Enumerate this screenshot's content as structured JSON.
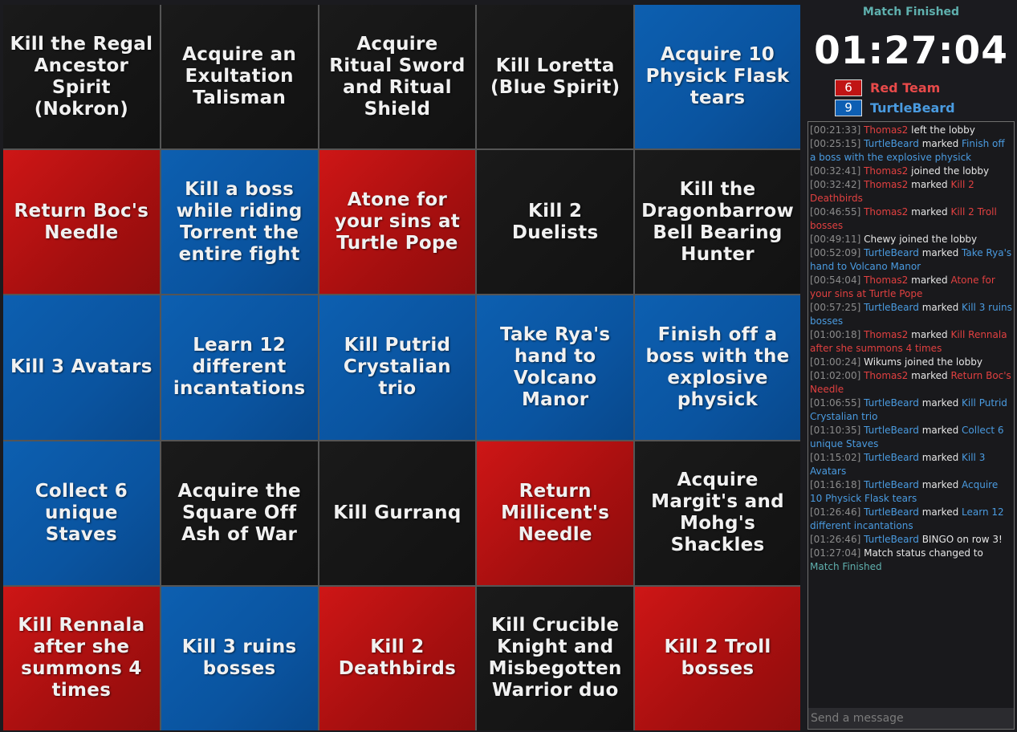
{
  "board": {
    "cells": [
      {
        "text": "Kill the Regal Ancestor Spirit (Nokron)",
        "owner": "none"
      },
      {
        "text": "Acquire an Exultation Talisman",
        "owner": "none"
      },
      {
        "text": "Acquire Ritual Sword and Ritual Shield",
        "owner": "none"
      },
      {
        "text": "Kill Loretta (Blue Spirit)",
        "owner": "none"
      },
      {
        "text": "Acquire 10 Physick Flask tears",
        "owner": "blue"
      },
      {
        "text": "Return Boc's Needle",
        "owner": "red"
      },
      {
        "text": "Kill a boss while riding Torrent the entire fight",
        "owner": "blue"
      },
      {
        "text": "Atone for your sins at Turtle Pope",
        "owner": "red"
      },
      {
        "text": "Kill 2 Duelists",
        "owner": "none"
      },
      {
        "text": "Kill the Dragonbarrow Bell Bearing Hunter",
        "owner": "none"
      },
      {
        "text": "Kill 3 Avatars",
        "owner": "blue"
      },
      {
        "text": "Learn 12 different incantations",
        "owner": "blue"
      },
      {
        "text": "Kill Putrid Crystalian trio",
        "owner": "blue"
      },
      {
        "text": "Take Rya's hand to Volcano Manor",
        "owner": "blue"
      },
      {
        "text": "Finish off a boss with the explosive physick",
        "owner": "blue"
      },
      {
        "text": "Collect 6 unique Staves",
        "owner": "blue"
      },
      {
        "text": "Acquire the Square Off Ash of War",
        "owner": "none"
      },
      {
        "text": "Kill Gurranq",
        "owner": "none"
      },
      {
        "text": "Return Millicent's Needle",
        "owner": "red"
      },
      {
        "text": "Acquire Margit's and Mohg's Shackles",
        "owner": "none"
      },
      {
        "text": "Kill Rennala after she summons 4 times",
        "owner": "red"
      },
      {
        "text": "Kill 3 ruins bosses",
        "owner": "blue"
      },
      {
        "text": "Kill 2 Deathbirds",
        "owner": "red"
      },
      {
        "text": "Kill Crucible Knight and Misbegotten Warrior duo",
        "owner": "none"
      },
      {
        "text": "Kill 2 Troll bosses",
        "owner": "red"
      }
    ]
  },
  "match": {
    "status": "Match Finished",
    "timer": "01:27:04"
  },
  "teams": {
    "red": {
      "count": "6",
      "name": "Red Team",
      "color": "#c01414"
    },
    "blue": {
      "count": "9",
      "name": "TurtleBeard",
      "color": "#0e5fb3"
    }
  },
  "chat": {
    "placeholder": "Send a message",
    "log": [
      {
        "time": "[00:21:33]",
        "user": "Thomas2",
        "team": "red",
        "action": " left the lobby",
        "goal": ""
      },
      {
        "time": "[00:25:15]",
        "user": "TurtleBeard",
        "team": "blue",
        "action": " marked ",
        "goal": "Finish off a boss with the explosive physick"
      },
      {
        "time": "[00:32:41]",
        "user": "Thomas2",
        "team": "red",
        "action": " joined the lobby",
        "goal": ""
      },
      {
        "time": "[00:32:42]",
        "user": "Thomas2",
        "team": "red",
        "action": " marked ",
        "goal": "Kill 2 Deathbirds"
      },
      {
        "time": "[00:46:55]",
        "user": "Thomas2",
        "team": "red",
        "action": " marked ",
        "goal": "Kill 2 Troll bosses"
      },
      {
        "time": "[00:49:11]",
        "user": "Chewy",
        "team": "plain",
        "action": " joined the lobby",
        "goal": ""
      },
      {
        "time": "[00:52:09]",
        "user": "TurtleBeard",
        "team": "blue",
        "action": " marked ",
        "goal": "Take Rya's hand to Volcano Manor"
      },
      {
        "time": "[00:54:04]",
        "user": "Thomas2",
        "team": "red",
        "action": " marked ",
        "goal": "Atone for your sins at Turtle Pope"
      },
      {
        "time": "[00:57:25]",
        "user": "TurtleBeard",
        "team": "blue",
        "action": " marked ",
        "goal": "Kill 3 ruins bosses"
      },
      {
        "time": "[01:00:18]",
        "user": "Thomas2",
        "team": "red",
        "action": " marked ",
        "goal": "Kill Rennala after she summons 4 times"
      },
      {
        "time": "[01:00:24]",
        "user": "Wikums",
        "team": "plain",
        "action": " joined the lobby",
        "goal": ""
      },
      {
        "time": "[01:02:00]",
        "user": "Thomas2",
        "team": "red",
        "action": " marked ",
        "goal": "Return Boc's Needle"
      },
      {
        "time": "[01:06:55]",
        "user": "TurtleBeard",
        "team": "blue",
        "action": " marked ",
        "goal": "Kill Putrid Crystalian trio"
      },
      {
        "time": "[01:10:35]",
        "user": "TurtleBeard",
        "team": "blue",
        "action": " marked ",
        "goal": "Collect 6 unique Staves"
      },
      {
        "time": "[01:15:02]",
        "user": "TurtleBeard",
        "team": "blue",
        "action": " marked ",
        "goal": "Kill 3 Avatars"
      },
      {
        "time": "[01:16:18]",
        "user": "TurtleBeard",
        "team": "blue",
        "action": " marked ",
        "goal": "Acquire 10 Physick Flask tears"
      },
      {
        "time": "[01:26:46]",
        "user": "TurtleBeard",
        "team": "blue",
        "action": " marked ",
        "goal": "Learn 12 different incantations"
      },
      {
        "time": "[01:26:46]",
        "user": "TurtleBeard",
        "team": "blue",
        "action": " BINGO on row 3!",
        "goal": ""
      },
      {
        "time": "[01:27:04]",
        "user": "",
        "team": "plain",
        "action": "Match status changed to ",
        "goal": "Match Finished",
        "goal_color": "teal"
      }
    ]
  }
}
